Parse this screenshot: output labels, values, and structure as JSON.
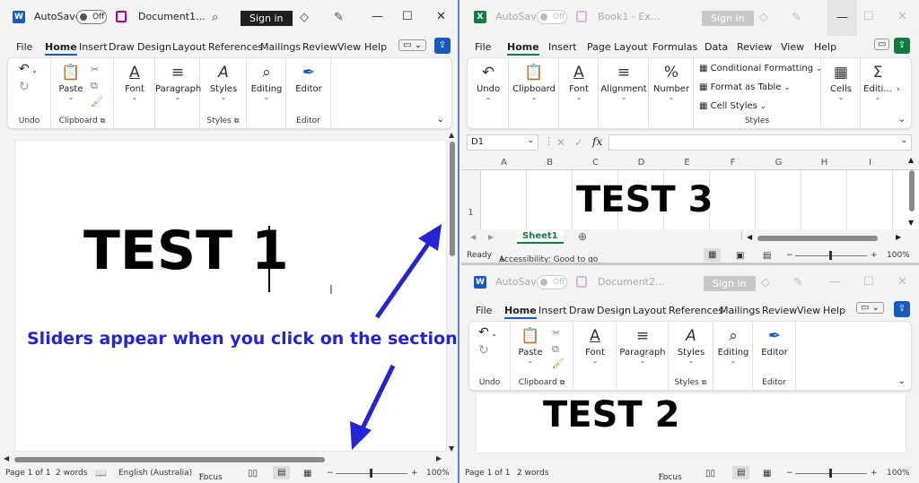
{
  "word1": {
    "app_icon": "W",
    "autosave_label": "AutoSave",
    "autosave_state": "Off",
    "doc_title": "Document1...",
    "sign_in": "Sign in",
    "menu": [
      "File",
      "Home",
      "Insert",
      "Draw",
      "Design",
      "Layout",
      "References",
      "Mailings",
      "Review",
      "View",
      "Help"
    ],
    "ribbon": {
      "undo_label": "Undo",
      "paste": "Paste",
      "clipboard": "Clipboard",
      "font": "Font",
      "paragraph": "Paragraph",
      "styles": "Styles",
      "styles_group": "Styles",
      "editing": "Editing",
      "editor": "Editor",
      "editor_group": "Editor"
    },
    "doc_text": "TEST 1",
    "status": {
      "page": "Page 1 of 1",
      "words": "2 words",
      "language": "English (Australia)",
      "focus": "Focus",
      "zoom": "100%"
    }
  },
  "annotation": {
    "text": "Sliders appear when you click on the section",
    "color": "#2424d6"
  },
  "excel": {
    "app_icon": "X",
    "autosave_label": "AutoSave",
    "autosave_state": "Off",
    "doc_title": "Book1 - Ex...",
    "sign_in": "Sign in",
    "menu": [
      "File",
      "Home",
      "Insert",
      "Page Layout",
      "Formulas",
      "Data",
      "Review",
      "View",
      "Help"
    ],
    "ribbon": {
      "undo": "Undo",
      "clipboard": "Clipboard",
      "font": "Font",
      "alignment": "Alignment",
      "number": "Number",
      "conditional_formatting": "Conditional Formatting",
      "format_as_table": "Format as Table",
      "cell_styles": "Cell Styles",
      "styles_group": "Styles",
      "cells": "Cells",
      "editing": "Editi..."
    },
    "name_box": "D1",
    "fx": "fx",
    "columns": [
      "A",
      "B",
      "C",
      "D",
      "E",
      "F",
      "G",
      "H",
      "I"
    ],
    "row": "1",
    "cell_text": "TEST 3",
    "sheet_tab": "Sheet1",
    "status": {
      "ready": "Ready",
      "accessibility": "Accessibility: Good to go",
      "zoom": "100%"
    }
  },
  "word2": {
    "app_icon": "W",
    "autosave_label": "AutoSave",
    "autosave_state": "Off",
    "doc_title": "Document2...",
    "sign_in": "Sign in",
    "menu": [
      "File",
      "Home",
      "Insert",
      "Draw",
      "Design",
      "Layout",
      "References",
      "Mailings",
      "Review",
      "View",
      "Help"
    ],
    "ribbon": {
      "undo_label": "Undo",
      "paste": "Paste",
      "clipboard": "Clipboard",
      "font": "Font",
      "paragraph": "Paragraph",
      "styles": "Styles",
      "styles_group": "Styles",
      "editing": "Editing",
      "editor": "Editor",
      "editor_group": "Editor"
    },
    "doc_text": "TEST 2",
    "status": {
      "page": "Page 1 of 1",
      "words": "2 words",
      "focus": "Focus",
      "zoom": "100%"
    }
  },
  "colors": {
    "word_blue": "#185abd",
    "excel_green": "#107c41",
    "annotation_blue": "#2424d6"
  }
}
